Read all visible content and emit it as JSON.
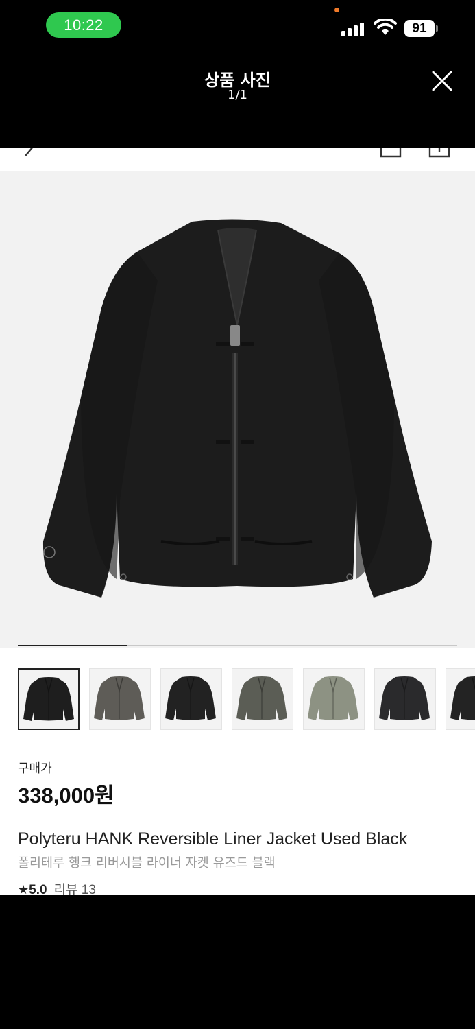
{
  "status_bar": {
    "time": "10:22",
    "battery": "91"
  },
  "modal": {
    "title": "상품 사진",
    "counter": "1/1"
  },
  "gallery": {
    "progress": 0.25,
    "thumbnail_count": 7,
    "active_index": 0,
    "thumbnail_colors": [
      "#1e1e1e",
      "#5e5c57",
      "#222222",
      "#5b5d55",
      "#8d9283",
      "#2a2a2c",
      "#232323"
    ]
  },
  "product": {
    "price_label": "구매가",
    "price": "338,000원",
    "name_en": "Polyteru HANK Reversible Liner Jacket Used Black",
    "name_ko": "폴리테루 행크 리버시블 라이너 자켓 유즈드 블랙",
    "rating": "5.0",
    "review_label": "리뷰 13"
  },
  "colors": {
    "status_green": "#2fc84f",
    "photo_bg": "#f2f2f2"
  }
}
